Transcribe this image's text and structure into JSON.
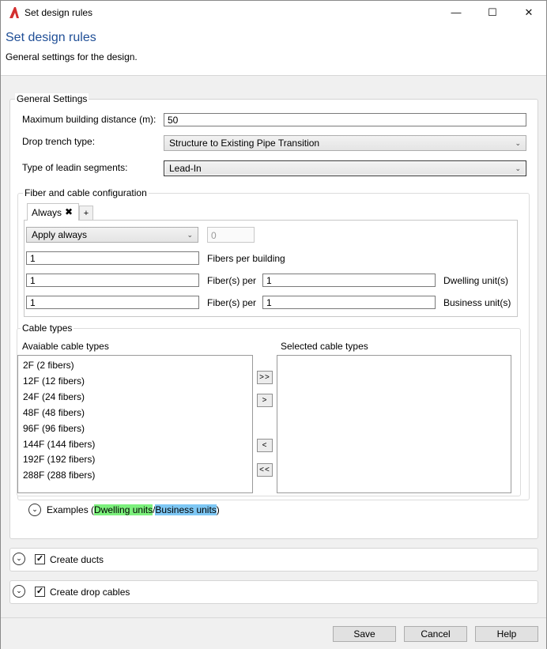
{
  "window": {
    "title": "Set design rules",
    "minimize": "—",
    "maximize": "☐",
    "close": "✕"
  },
  "header": {
    "title": "Set design rules",
    "subtitle": "General settings for the design."
  },
  "general": {
    "legend": "General Settings",
    "max_distance_label": "Maximum building distance (m):",
    "max_distance_value": "50",
    "drop_trench_label": "Drop trench type:",
    "drop_trench_value": "Structure to Existing Pipe Transition",
    "leadin_label": "Type of leadin segments:",
    "leadin_value": "Lead-In"
  },
  "fiber": {
    "legend": "Fiber and cable configuration",
    "tabs": [
      {
        "label": "Always",
        "close": "✖"
      },
      {
        "label": "+"
      }
    ],
    "apply_value": "Apply always",
    "apply_number": "0",
    "fibers_per_building_value": "1",
    "fibers_per_building_label": "Fibers per building",
    "dwelling_fibers_value": "1",
    "dwelling_per_label": "Fiber(s) per",
    "dwelling_units_value": "1",
    "dwelling_units_label": "Dwelling unit(s)",
    "business_fibers_value": "1",
    "business_per_label": "Fiber(s) per",
    "business_units_value": "1",
    "business_units_label": "Business unit(s)"
  },
  "cable_types": {
    "legend": "Cable types",
    "available_label": "Avaiable cable types",
    "selected_label": "Selected cable types",
    "available": [
      "2F (2 fibers)",
      "12F (12 fibers)",
      "24F (24 fibers)",
      "48F (48 fibers)",
      "96F (96 fibers)",
      "144F (144 fibers)",
      "192F (192 fibers)",
      "288F (288 fibers)"
    ],
    "selected": [],
    "add_all": ">>",
    "add": ">",
    "remove": "<",
    "remove_all": "<<"
  },
  "examples": {
    "prefix": "Examples (",
    "dwelling": "Dwelling units",
    "separator": "/",
    "business": "Business units",
    "suffix": ")",
    "dwelling_color": "#7cf07c",
    "business_color": "#7ec7f4"
  },
  "sections": {
    "ducts_label": "Create ducts",
    "ducts_checked": true,
    "drop_cables_label": "Create drop cables",
    "drop_cables_checked": true,
    "check_mark": "✓",
    "expand_glyph": "⌄"
  },
  "footer": {
    "save": "Save",
    "cancel": "Cancel",
    "help": "Help"
  },
  "colors": {
    "accent_title": "#1f4e96",
    "app_icon": "#d32f2f"
  }
}
